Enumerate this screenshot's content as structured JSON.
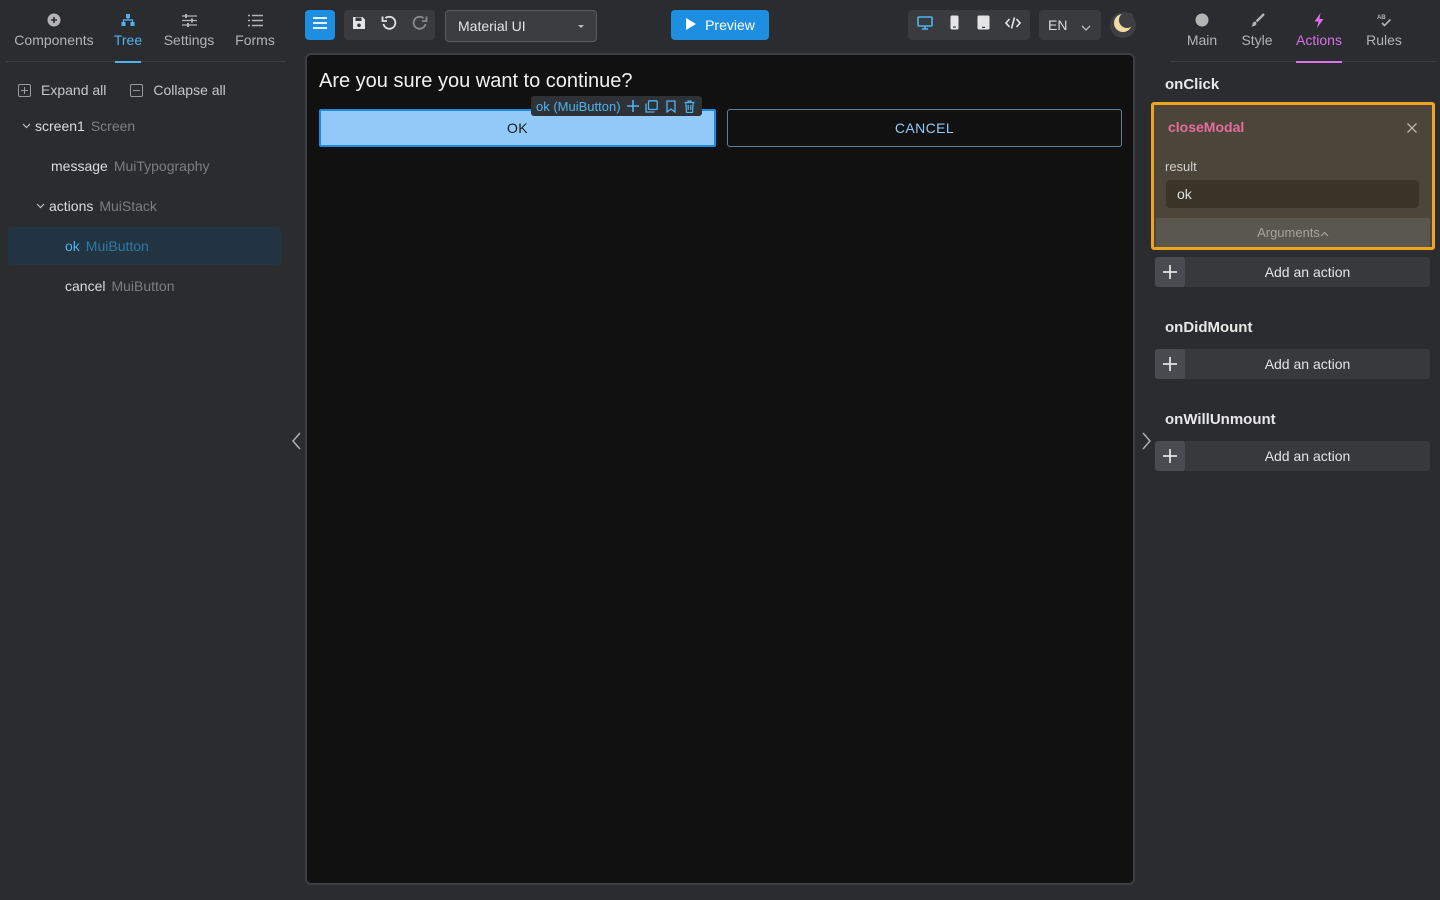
{
  "left_tabs": [
    {
      "label": "Components",
      "icon": "add-circle-icon"
    },
    {
      "label": "Tree",
      "icon": "tree-icon",
      "active": true
    },
    {
      "label": "Settings",
      "icon": "sliders-icon"
    },
    {
      "label": "Forms",
      "icon": "list-icon"
    }
  ],
  "tree_tools": {
    "expand_all": "Expand all",
    "collapse_all": "Collapse all"
  },
  "tree": [
    {
      "name": "screen1",
      "type": "Screen"
    },
    {
      "name": "message",
      "type": "MuiTypography"
    },
    {
      "name": "actions",
      "type": "MuiStack"
    },
    {
      "name": "ok",
      "type": "MuiButton",
      "selected": true
    },
    {
      "name": "cancel",
      "type": "MuiButton"
    }
  ],
  "toolbar": {
    "library_select": "Material UI",
    "preview_label": "Preview",
    "language": "EN"
  },
  "canvas": {
    "dialog_title": "Are you sure you want to continue?",
    "ok_label": "OK",
    "cancel_label": "CANCEL",
    "selection_label": "ok (MuiButton)"
  },
  "right_tabs": [
    {
      "label": "Main",
      "icon": "circle-icon"
    },
    {
      "label": "Style",
      "icon": "brush-icon"
    },
    {
      "label": "Actions",
      "icon": "bolt-icon",
      "active": true
    },
    {
      "label": "Rules",
      "icon": "spellcheck-icon"
    }
  ],
  "events": {
    "onclick": "onClick",
    "ondidmount": "onDidMount",
    "onwillunmount": "onWillUnmount",
    "add_action": "Add an action"
  },
  "action_card": {
    "name": "closeModal",
    "arg_label": "result",
    "arg_value": "ok",
    "args_toggle": "Arguments"
  },
  "colors": {
    "accent_blue": "#4fb3ef",
    "actions_pink": "#d872e6",
    "card_border": "#f0a420",
    "action_name": "#e86ba0"
  }
}
